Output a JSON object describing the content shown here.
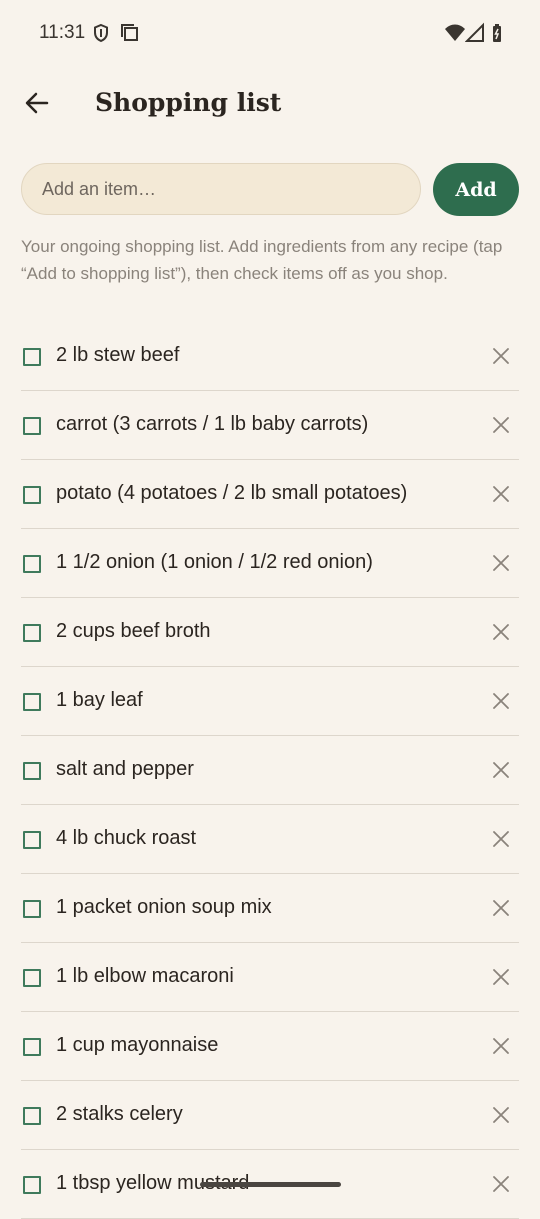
{
  "status_bar": {
    "time": "11:31",
    "left_icons": [
      "shield-icon",
      "screen-copy-icon"
    ],
    "right_icons": [
      "wifi-icon",
      "signal-icon",
      "battery-icon"
    ]
  },
  "header": {
    "back_icon": "arrow-left-icon",
    "title": "Shopping list"
  },
  "add_row": {
    "placeholder": "Add an item…",
    "value": "",
    "button_label": "Add"
  },
  "helper_text": "Your ongoing shopping list. Add ingredients from any recipe (tap “Add to shopping list”), then check items off as you shop.",
  "items": [
    {
      "label": "2 lb stew beef",
      "checked": false
    },
    {
      "label": "carrot (3 carrots / 1 lb baby carrots)",
      "checked": false
    },
    {
      "label": "potato (4 potatoes / 2 lb small potatoes)",
      "checked": false
    },
    {
      "label": "1 1/2 onion (1 onion / 1/2 red onion)",
      "checked": false
    },
    {
      "label": "2 cups beef broth",
      "checked": false
    },
    {
      "label": "1 bay leaf",
      "checked": false
    },
    {
      "label": "salt and pepper",
      "checked": false
    },
    {
      "label": "4 lb chuck roast",
      "checked": false
    },
    {
      "label": "1 packet onion soup mix",
      "checked": false
    },
    {
      "label": "1 lb elbow macaroni",
      "checked": false
    },
    {
      "label": "1 cup mayonnaise",
      "checked": false
    },
    {
      "label": "2 stalks celery",
      "checked": false
    },
    {
      "label": "1 tbsp yellow mustard",
      "checked": false
    }
  ],
  "colors": {
    "background": "#f8f3ec",
    "accent": "#2e6d4e",
    "input_fill": "#f3e9d6"
  }
}
